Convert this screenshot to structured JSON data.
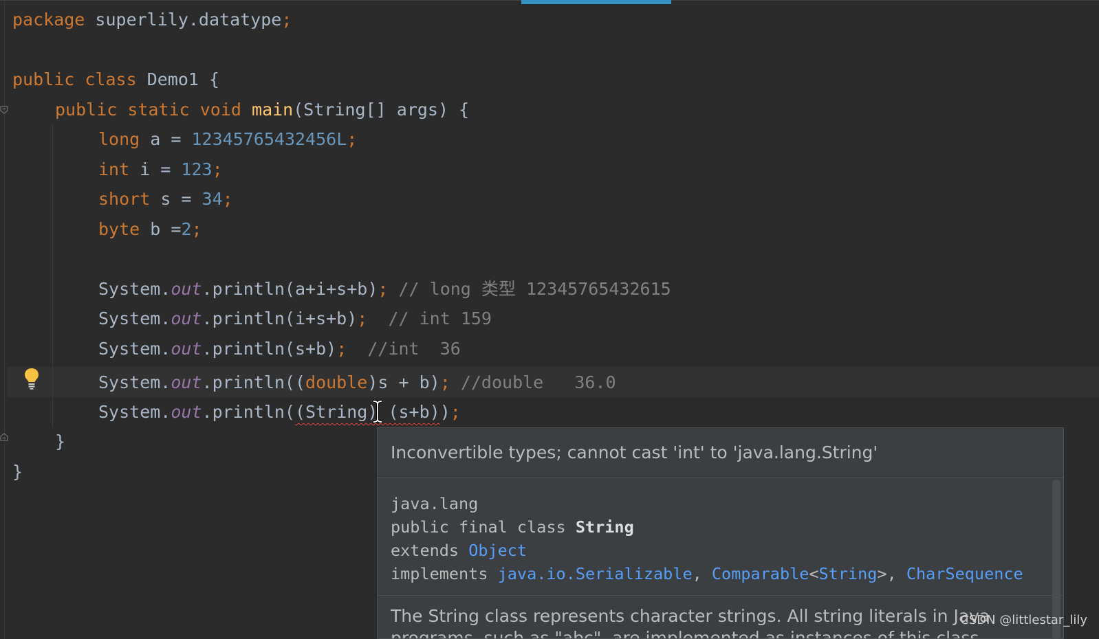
{
  "code": {
    "package_kw": "package",
    "package_name": " superlily.datatype",
    "semicolon": ";",
    "line_class": {
      "kw1": "public",
      "kw2": "class",
      "name": " Demo1 {"
    },
    "line_main": {
      "kw1": "public",
      "kw2": "static",
      "kw3": "void",
      "fn": "main",
      "rest": "(String[] args) {"
    },
    "line_long": {
      "kw": "long",
      "rest": " a = ",
      "num": "12345765432456L"
    },
    "line_int": {
      "kw": "int",
      "rest": " i = ",
      "num": "123"
    },
    "line_short": {
      "kw": "short",
      "rest": " s = ",
      "num": "34"
    },
    "line_byte": {
      "kw": "byte",
      "rest": " b =",
      "num": "2"
    },
    "sys": "System.",
    "out": "out",
    "print1": {
      "call": ".println(a+i+s+b)",
      "comment": " // long 类型 12345765432615"
    },
    "print2": {
      "call": ".println(i+s+b)",
      "comment": "  // int 159"
    },
    "print3": {
      "call": ".println(s+b)",
      "comment": "  //int  36"
    },
    "print4": {
      "open": ".println((",
      "kw": "double",
      "close": ")s + b)",
      "comment": " //double   36.0"
    },
    "print5": {
      "open": ".println(",
      "err": "(String) (s+b)",
      "close": ")"
    },
    "close_method": "}",
    "close_class": "}"
  },
  "popup": {
    "error": "Inconvertible types; cannot cast 'int' to 'java.lang.String'",
    "package": "java.lang",
    "decl": "public final class ",
    "class_name": "String",
    "extends_kw": "extends ",
    "extends_link": "Object",
    "implements_kw": "implements ",
    "impl1": "java.io.Serializable",
    "comma": ", ",
    "impl2": "Comparable",
    "lt": "<",
    "impl2_arg": "String",
    "gt": ">",
    "impl3": "CharSequence",
    "description": "The String class represents character strings. All string literals in Java programs, such as \"abc\", are implemented as instances of this class."
  },
  "watermark": "CSDN @littlestar_lily",
  "colors": {
    "background": "#2b2b2b",
    "keyword": "#cc7832",
    "number": "#6897bb",
    "function": "#ffc66d",
    "field": "#9876aa",
    "comment": "#808080",
    "link": "#589df6",
    "tab_accent": "#3592c4"
  },
  "icons": [
    "fold-icon",
    "lightbulb-icon",
    "text-cursor-icon"
  ]
}
